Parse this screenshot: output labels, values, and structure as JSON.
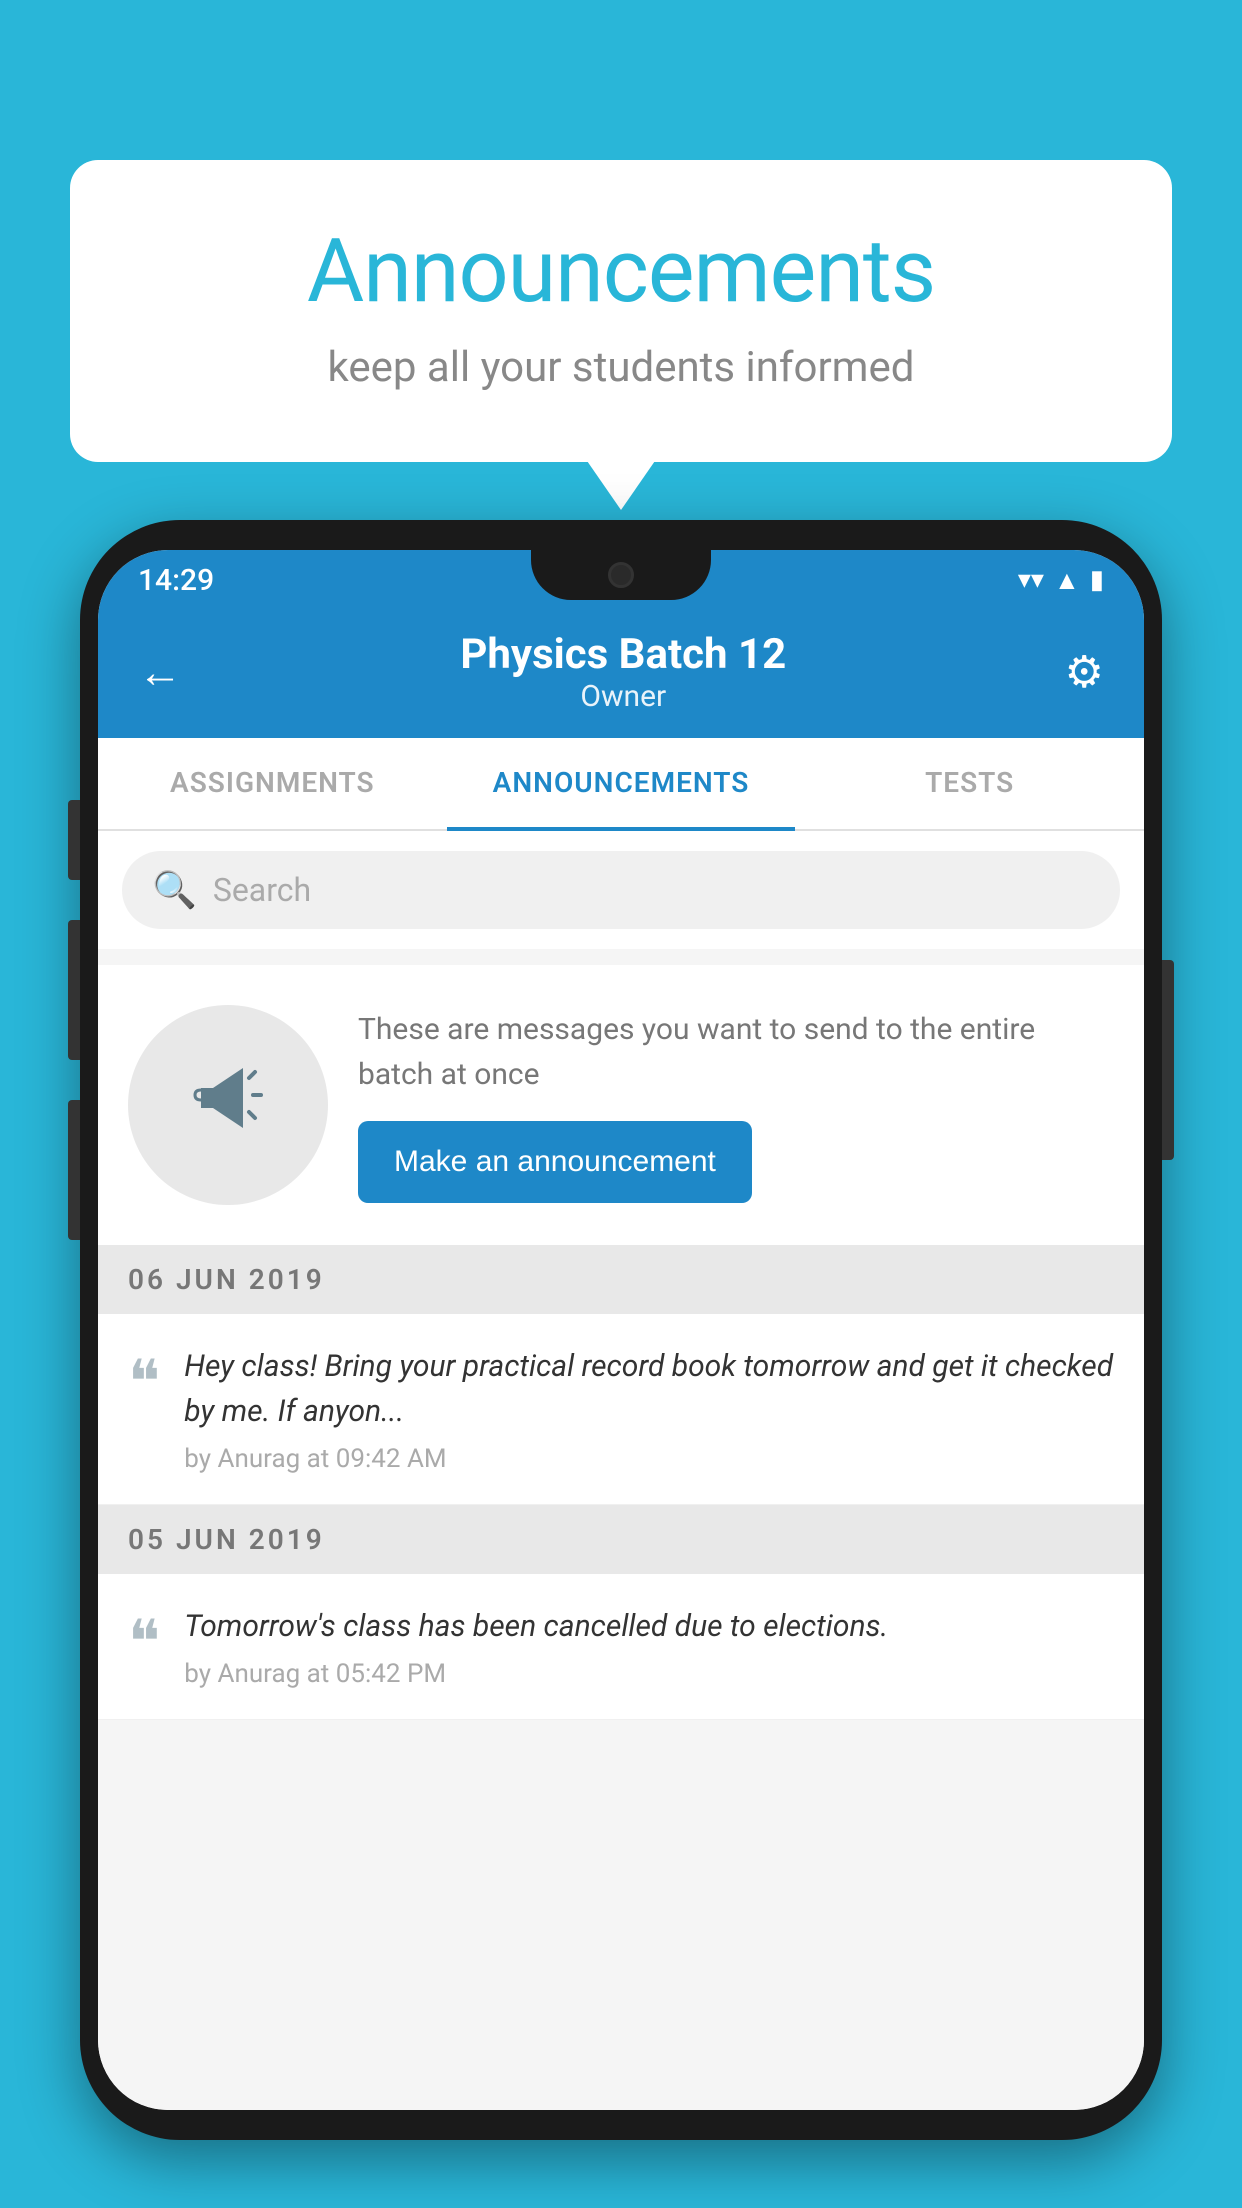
{
  "background_color": "#29b6d8",
  "speech_bubble": {
    "title": "Announcements",
    "subtitle": "keep all your students informed"
  },
  "phone": {
    "status_bar": {
      "time": "14:29",
      "wifi_icon": "▲",
      "signal_icon": "▲",
      "battery_icon": "▮"
    },
    "header": {
      "back_label": "←",
      "title": "Physics Batch 12",
      "subtitle": "Owner",
      "settings_label": "⚙"
    },
    "tabs": [
      {
        "label": "ASSIGNMENTS",
        "active": false
      },
      {
        "label": "ANNOUNCEMENTS",
        "active": true
      },
      {
        "label": "TESTS",
        "active": false
      }
    ],
    "search": {
      "placeholder": "Search"
    },
    "promo": {
      "description_text": "These are messages you want to send to the entire batch at once",
      "button_label": "Make an announcement"
    },
    "announcements": [
      {
        "date": "06  JUN  2019",
        "message": "Hey class! Bring your practical record book tomorrow and get it checked by me. If anyon...",
        "meta": "by Anurag at 09:42 AM"
      },
      {
        "date": "05  JUN  2019",
        "message": "Tomorrow's class has been cancelled due to elections.",
        "meta": "by Anurag at 05:42 PM"
      }
    ]
  }
}
